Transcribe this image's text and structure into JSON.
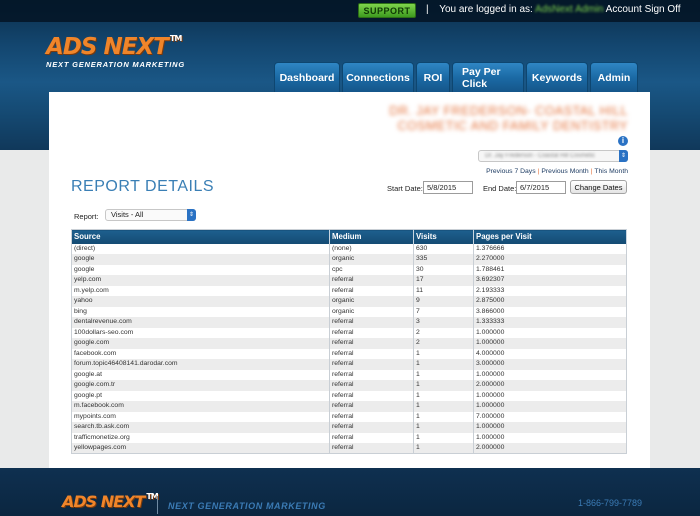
{
  "topbar": {
    "support_label": "SUPPORT",
    "separator": "|",
    "logged_in_prefix": "You are logged in as:",
    "user_name": "AdsNext Admin",
    "account_link": "Account",
    "signout_link": "Sign Off"
  },
  "brand": {
    "logo_text": "ADS NEXT",
    "logo_tm": "TM",
    "tagline": "NEXT GENERATION MARKETING",
    "accent_color": "#f0852a",
    "primary_color": "#1b6aa5"
  },
  "nav": {
    "tabs": [
      "Dashboard",
      "Connections",
      "ROI",
      "Pay Per Click",
      "Keywords",
      "Admin"
    ]
  },
  "practice": {
    "name_line1": "DR. JAY FREDERSON- COASTAL HILL",
    "name_line2": "COSMETIC AND FAMILY DENTISTRY",
    "select_value": "Dr. Jay Frederson - Coastal Hill Cosmetic"
  },
  "quick_links": {
    "prev7": "Previous 7 Days",
    "prev_month": "Previous Month",
    "this_month": "This Month",
    "separator": "|"
  },
  "report": {
    "title": "REPORT DETAILS",
    "start_label": "Start Date:",
    "start_value": "5/8/2015",
    "end_label": "End Date:",
    "end_value": "6/7/2015",
    "change_button": "Change Dates",
    "report_label": "Report:",
    "report_value": "Visits - All"
  },
  "table": {
    "headers": [
      "Source",
      "Medium",
      "Visits",
      "Pages per Visit"
    ],
    "rows": [
      [
        "(direct)",
        "(none)",
        "630",
        "1.376666"
      ],
      [
        "google",
        "organic",
        "335",
        "2.270000"
      ],
      [
        "google",
        "cpc",
        "30",
        "1.788461"
      ],
      [
        "yelp.com",
        "referral",
        "17",
        "3.692307"
      ],
      [
        "m.yelp.com",
        "referral",
        "11",
        "2.193333"
      ],
      [
        "yahoo",
        "organic",
        "9",
        "2.875000"
      ],
      [
        "bing",
        "organic",
        "7",
        "3.866000"
      ],
      [
        "dentalrevenue.com",
        "referral",
        "3",
        "1.333333"
      ],
      [
        "100dollars-seo.com",
        "referral",
        "2",
        "1.000000"
      ],
      [
        "google.com",
        "referral",
        "2",
        "1.000000"
      ],
      [
        "facebook.com",
        "referral",
        "1",
        "4.000000"
      ],
      [
        "forum.topic46408141.darodar.com",
        "referral",
        "1",
        "3.000000"
      ],
      [
        "google.at",
        "referral",
        "1",
        "1.000000"
      ],
      [
        "google.com.tr",
        "referral",
        "1",
        "2.000000"
      ],
      [
        "google.pt",
        "referral",
        "1",
        "1.000000"
      ],
      [
        "m.facebook.com",
        "referral",
        "1",
        "1.000000"
      ],
      [
        "mypoints.com",
        "referral",
        "1",
        "7.000000"
      ],
      [
        "search.tb.ask.com",
        "referral",
        "1",
        "1.000000"
      ],
      [
        "trafficmonetize.org",
        "referral",
        "1",
        "1.000000"
      ],
      [
        "yellowpages.com",
        "referral",
        "1",
        "2.000000"
      ]
    ]
  },
  "footer": {
    "tagline": "NEXT GENERATION MARKETING",
    "phone": "1-866-799-7789"
  }
}
